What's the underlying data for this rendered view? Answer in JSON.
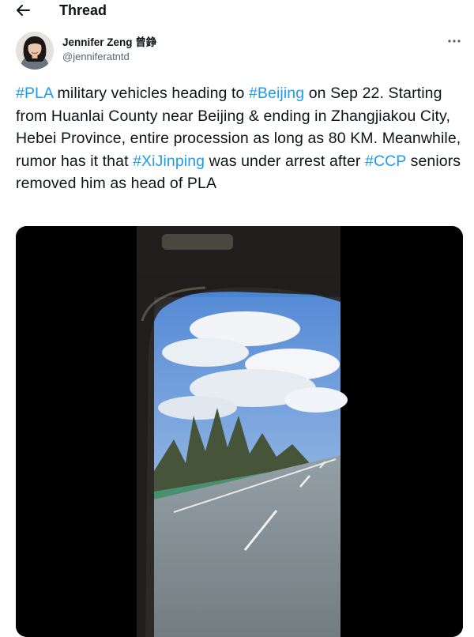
{
  "header": {
    "back_icon": "arrow-left-icon",
    "title": "Thread"
  },
  "author": {
    "name": "Jennifer Zeng 曾錚",
    "handle": "@jenniferatntd",
    "avatar_icon": "profile-photo"
  },
  "more_icon": "ellipsis-icon",
  "tweet": {
    "segments": [
      {
        "text": "#PLA",
        "hashtag": true
      },
      {
        "text": " military vehicles heading to ",
        "hashtag": false
      },
      {
        "text": "#Beijing",
        "hashtag": true
      },
      {
        "text": " on Sep 22. Starting from Huanlai County near Beijing & ending in Zhangjiakou City, Hebei Province, entire procession as long as 80 KM. Meanwhile, rumor has it that ",
        "hashtag": false
      },
      {
        "text": "#XiJinping",
        "hashtag": true
      },
      {
        "text": " was under arrest after ",
        "hashtag": false
      },
      {
        "text": "#CCP",
        "hashtag": true
      },
      {
        "text": " seniors removed him as head of PLA",
        "hashtag": false
      }
    ]
  },
  "media": {
    "kind": "video",
    "scene": "car-window-highway"
  },
  "colors": {
    "hashtag": "#1d9bf0",
    "text": "#0f1419",
    "secondary": "#536471"
  }
}
